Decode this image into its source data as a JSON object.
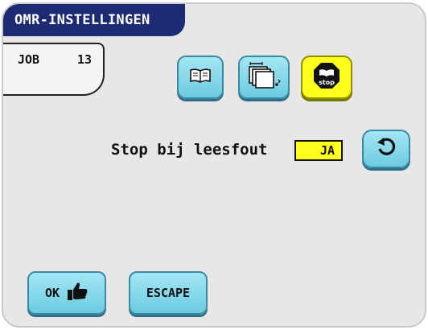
{
  "header": {
    "title": "OMR-INSTELLINGEN"
  },
  "job": {
    "label": "JOB",
    "number": "13"
  },
  "toolbar": {
    "icons": [
      "book-icon",
      "sheet-stack-icon",
      "stop-icon"
    ],
    "stop_icon_text": "stop"
  },
  "setting": {
    "label": "Stop bij leesfout",
    "value": "JA"
  },
  "actions": {
    "ok_label": "OK",
    "escape_label": "ESCAPE"
  },
  "colors": {
    "header_background": "#1c2b73",
    "button_cyan": "#8fdcee",
    "active_yellow": "#ffff1e",
    "panel_background": "#e7e7e7"
  }
}
